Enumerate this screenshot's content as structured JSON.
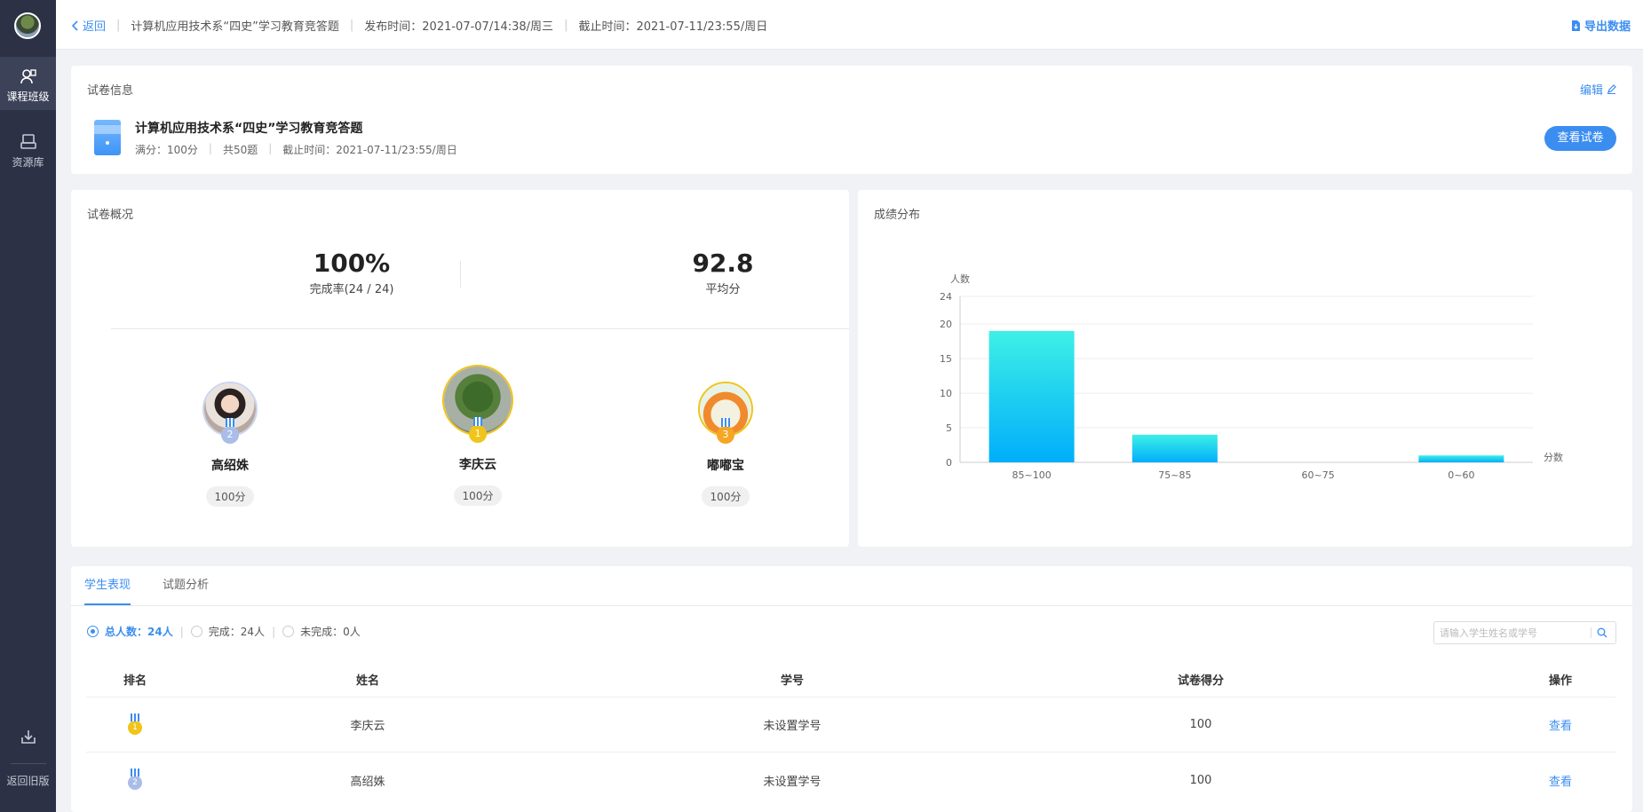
{
  "sidebar": {
    "items": [
      {
        "label": "课程班级",
        "active": true,
        "icon": "class-icon"
      },
      {
        "label": "资源库",
        "active": false,
        "icon": "library-icon"
      }
    ],
    "bottom_label": "返回旧版",
    "bottom_icon": "download-icon"
  },
  "topbar": {
    "back_label": "返回",
    "title": "计算机应用技术系“四史”学习教育竞答题",
    "publish_time": "发布时间：2021-07-07/14:38/周三",
    "deadline": "截止时间：2021-07-11/23:55/周日",
    "export_label": "导出数据"
  },
  "exam_info": {
    "section_title": "试卷信息",
    "edit_label": "编辑",
    "name": "计算机应用技术系“四史”学习教育竞答题",
    "full_score": "满分：100分",
    "question_count": "共50题",
    "deadline": "截止时间：2021-07-11/23:55/周日",
    "view_button": "查看试卷"
  },
  "overview": {
    "section_title": "试卷概况",
    "completion_rate": "100%",
    "completion_label": "完成率(24 / 24)",
    "average": "92.8",
    "average_label": "平均分",
    "podium": [
      {
        "rank": "2",
        "name": "高绍姝",
        "score": "100分"
      },
      {
        "rank": "1",
        "name": "李庆云",
        "score": "100分"
      },
      {
        "rank": "3",
        "name": "嘟嘟宝",
        "score": "100分"
      }
    ]
  },
  "distribution": {
    "section_title": "成绩分布"
  },
  "chart_data": {
    "type": "bar",
    "title": "成绩分布",
    "xlabel": "分数",
    "ylabel": "人数",
    "categories": [
      "85~100",
      "75~85",
      "60~75",
      "0~60"
    ],
    "values": [
      19,
      4,
      0,
      1
    ],
    "yticks": [
      0,
      5,
      10,
      15,
      20,
      24
    ],
    "ylim": [
      0,
      24
    ],
    "grid": true,
    "color_top": "#3ef0e6",
    "color_bottom": "#00aefa"
  },
  "students": {
    "tabs": [
      {
        "label": "学生表现",
        "active": true
      },
      {
        "label": "试题分析",
        "active": false
      }
    ],
    "filters": [
      {
        "label": "总人数：",
        "value": "24人",
        "active": true
      },
      {
        "label": "完成：",
        "value": "24人",
        "active": false
      },
      {
        "label": "未完成：",
        "value": "0人",
        "active": false
      }
    ],
    "search_placeholder": "请输入学生姓名或学号",
    "columns": [
      "排名",
      "姓名",
      "学号",
      "试卷得分",
      "操作"
    ],
    "rows": [
      {
        "rank": "1",
        "name": "李庆云",
        "student_id": "未设置学号",
        "score": "100",
        "action": "查看"
      },
      {
        "rank": "2",
        "name": "高绍姝",
        "student_id": "未设置学号",
        "score": "100",
        "action": "查看"
      }
    ]
  },
  "colors": {
    "accent": "#3b8ef0",
    "sidebar_bg": "#2d3145",
    "gold": "#f0c419",
    "silver": "#a9bde8",
    "bronze": "#f5a623"
  }
}
